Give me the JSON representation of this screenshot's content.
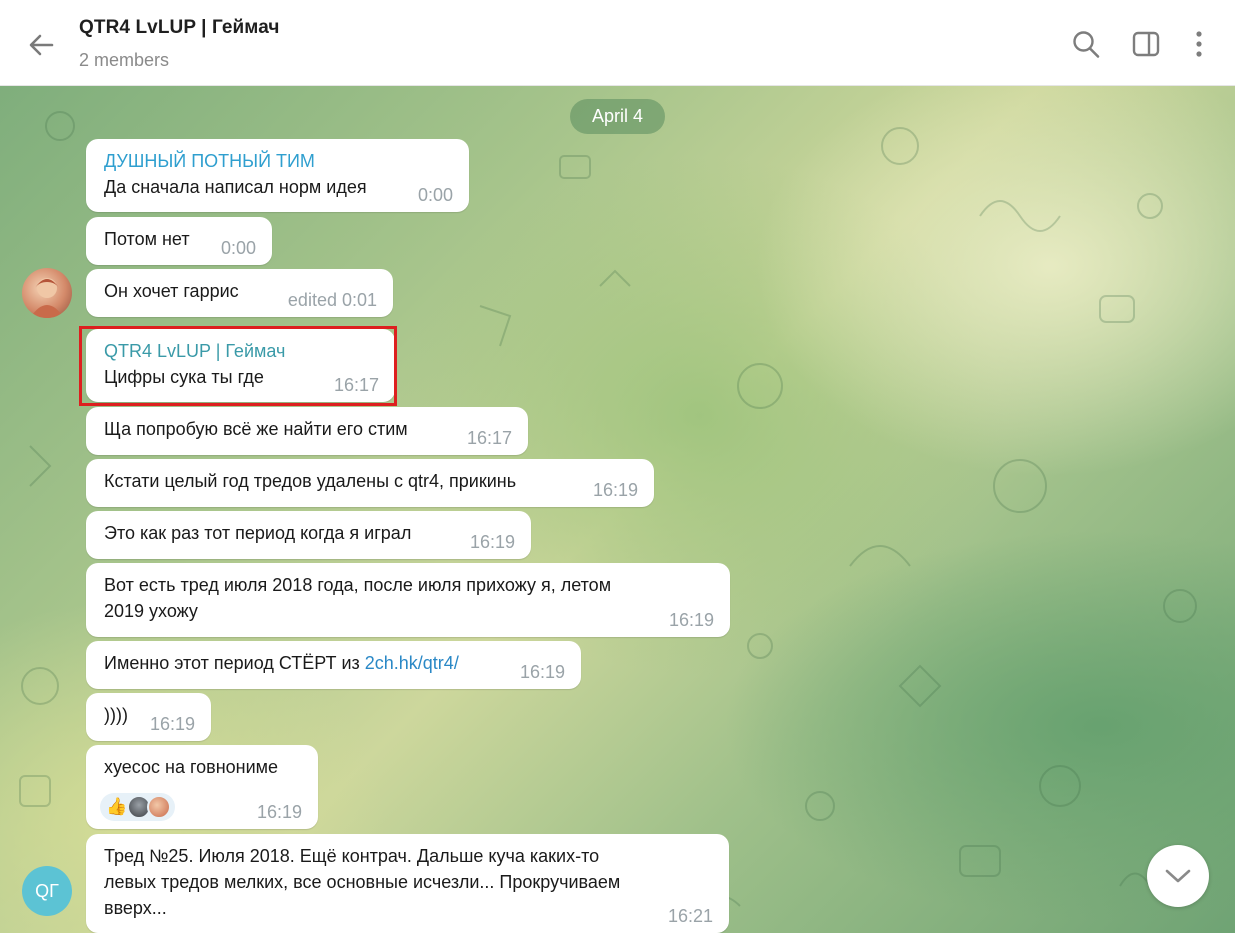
{
  "header": {
    "title": "QTR4 LvLUP | Геймач",
    "subtitle": "2 members",
    "icons": [
      "back-arrow-icon",
      "search-icon",
      "sidebar-toggle-icon",
      "more-vertical-icon"
    ]
  },
  "chat": {
    "date_label": "April 4",
    "messages": [
      {
        "sender": "ДУШНЫЙ ПОТНЫЙ ТИМ",
        "text": "Да сначала написал норм идея",
        "time": "0:00"
      },
      {
        "text": "Потом нет",
        "time": "0:00"
      },
      {
        "text": "Он хочет гаррис",
        "time": "edited 0:01"
      },
      {
        "sender": "QTR4 LvLUP | Геймач",
        "text": "Цифры сука ты где",
        "time": "16:17"
      },
      {
        "text": "Ща попробую всё же найти его стим",
        "time": "16:17"
      },
      {
        "text": "Кстати целый год тредов удалены с qtr4, прикинь",
        "time": "16:19"
      },
      {
        "text": "Это как раз тот период когда я играл",
        "time": "16:19"
      },
      {
        "text_line1": "Вот есть тред июля 2018 года, после июля прихожу я, летом",
        "text_line2": "2019 ухожу",
        "time": "16:19"
      },
      {
        "text": "Именно этот период СТЁРТ из ",
        "link": "2ch.hk/qtr4/",
        "time": "16:19"
      },
      {
        "text": "))))",
        "time": "16:19"
      },
      {
        "text": "хуесос на говнониме",
        "time": "16:19",
        "reactions": [
          "thumbs-up-emoji",
          "reactor-avatar",
          "reactor-avatar"
        ]
      },
      {
        "text_line1": "Тред №25. Июля 2018. Ещё контрач. Дальше куча каких-то",
        "text_line2": "левых тредов мелких, все основные исчезли... Прокручиваем",
        "text_line3": "вверх...",
        "time": "16:21"
      }
    ],
    "avatar_initials": "QГ"
  },
  "colors": {
    "sender_tim": "#2f9fcf",
    "sender_qtr4": "#3a9aa8",
    "link": "#2a88c6",
    "highlight_border": "#dd1f1f",
    "avatar_bg": "#5cc3d4"
  }
}
